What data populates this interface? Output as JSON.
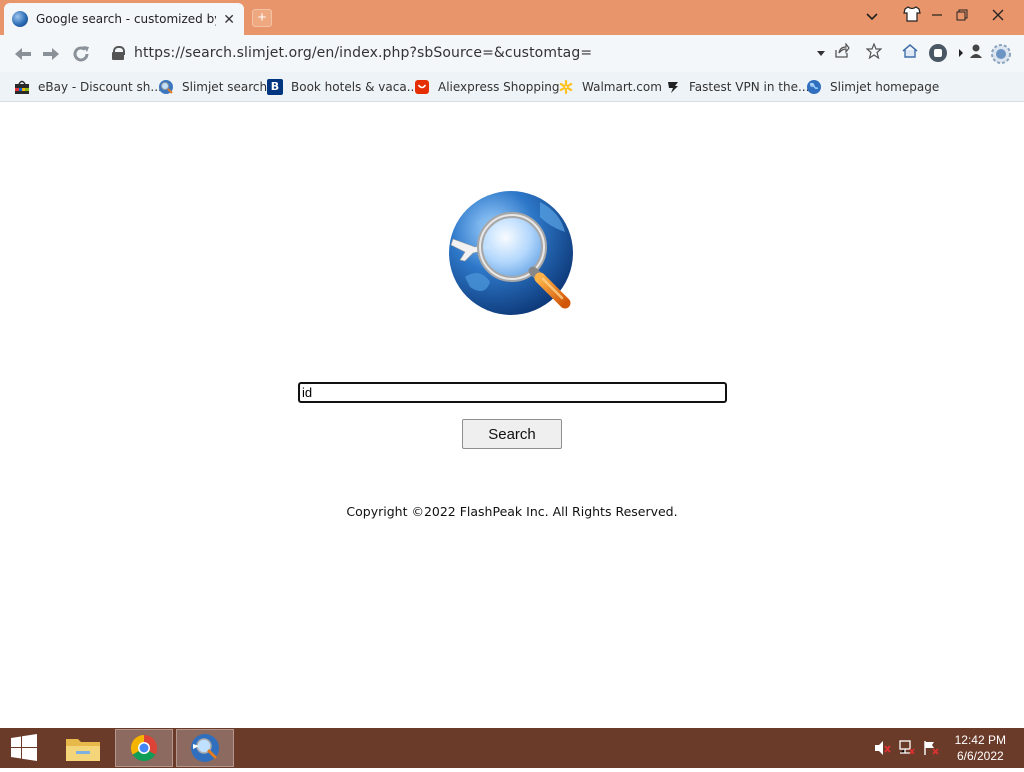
{
  "tab": {
    "title": "Google search - customized by Fla",
    "close": "✕",
    "new_tab": "+"
  },
  "window": {
    "buttons": [
      "minimize",
      "restore",
      "close"
    ]
  },
  "toolbar": {
    "url": "https://search.slimjet.org/en/index.php?sbSource=&customtag="
  },
  "bookmarks": [
    {
      "label": "eBay - Discount sh...",
      "icon": "shopping-bag-icon"
    },
    {
      "label": "Slimjet search",
      "icon": "globe-search-icon"
    },
    {
      "label": "Book hotels & vaca...",
      "icon": "booking-icon"
    },
    {
      "label": "Aliexpress Shopping",
      "icon": "aliexpress-icon"
    },
    {
      "label": "Walmart.com",
      "icon": "walmart-icon"
    },
    {
      "label": "Fastest VPN in the...",
      "icon": "vpn-icon"
    },
    {
      "label": "Slimjet homepage",
      "icon": "globe-icon"
    }
  ],
  "search": {
    "value": "id",
    "button_label": "Search"
  },
  "footer": {
    "copyright": "Copyright ©2022 FlashPeak Inc. All Rights Reserved."
  },
  "taskbar": {
    "time": "12:42 PM",
    "date": "6/6/2022"
  },
  "colors": {
    "titlebar": "#e9956b",
    "taskbar": "#6b3b2a"
  }
}
